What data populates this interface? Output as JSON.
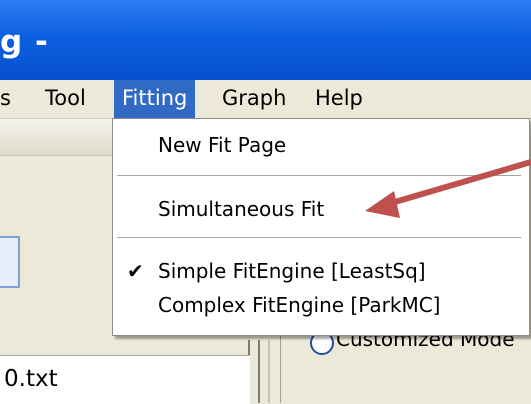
{
  "window": {
    "title_fragment": "g -"
  },
  "menubar": {
    "items": [
      {
        "label": "s"
      },
      {
        "label": "Tool"
      },
      {
        "label": "Fitting"
      },
      {
        "label": "Graph"
      },
      {
        "label": "Help"
      }
    ]
  },
  "fitting_menu": {
    "items": [
      {
        "label": "New Fit Page"
      },
      {
        "label": "Simultaneous Fit"
      },
      {
        "label": "Simple FitEngine  [LeastSq]",
        "checked": true
      },
      {
        "label": "Complex FitEngine [ParkMC]"
      }
    ]
  },
  "panel": {
    "radio_label": "Customized Mode",
    "file_name": "0.txt"
  },
  "colors": {
    "titlebar": "#0c5fe0",
    "menu_highlight": "#316ac5",
    "arrow": "#c0504d"
  },
  "icons": {
    "check": "checkmark-icon"
  }
}
